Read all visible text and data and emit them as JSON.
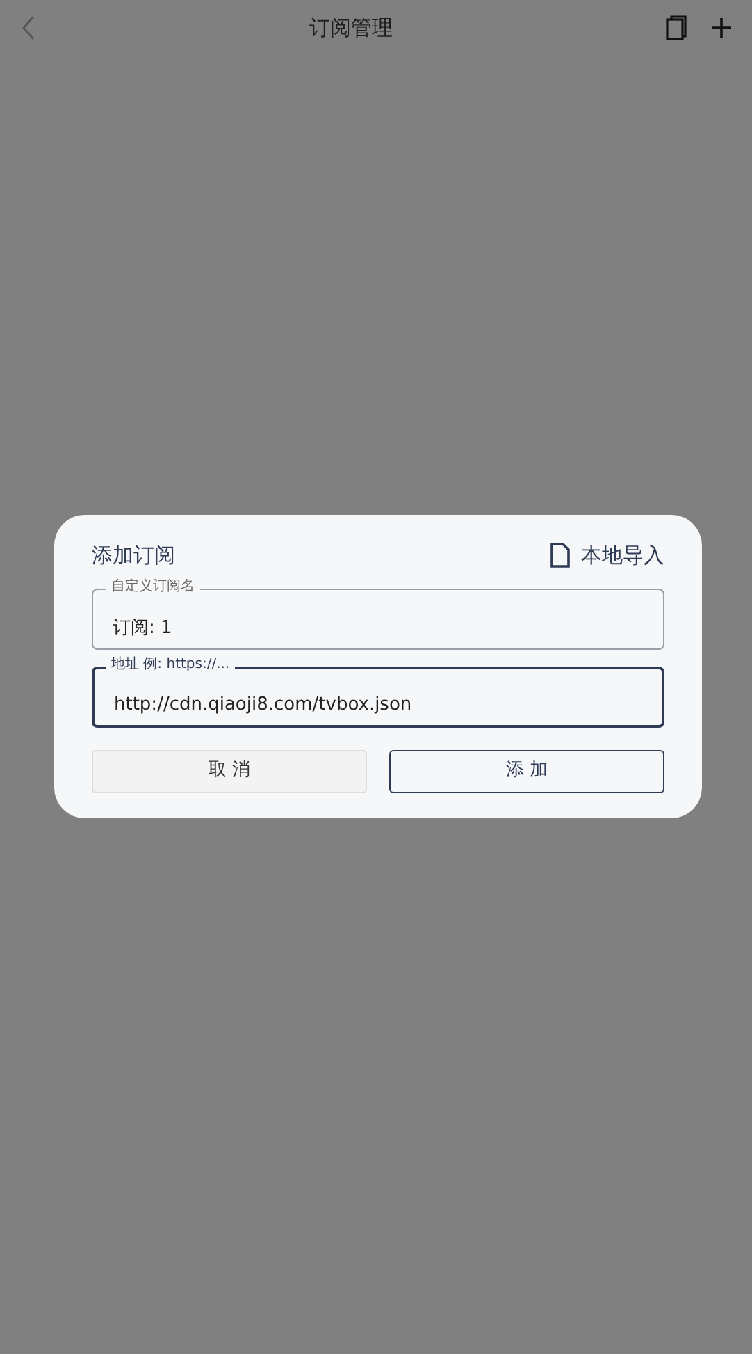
{
  "app_bar": {
    "title": "订阅管理"
  },
  "dialog": {
    "title": "添加订阅",
    "import_button": "本地导入",
    "fields": [
      {
        "label": "自定义订阅名",
        "value": "订阅: 1",
        "focused": false
      },
      {
        "label": "地址 例: https://...",
        "value": "http://cdn.qiaoji8.com/tvbox.json",
        "focused": true
      }
    ],
    "buttons": [
      {
        "label": "取 消",
        "kind": "text"
      },
      {
        "label": "添 加",
        "kind": "outlined"
      }
    ]
  }
}
